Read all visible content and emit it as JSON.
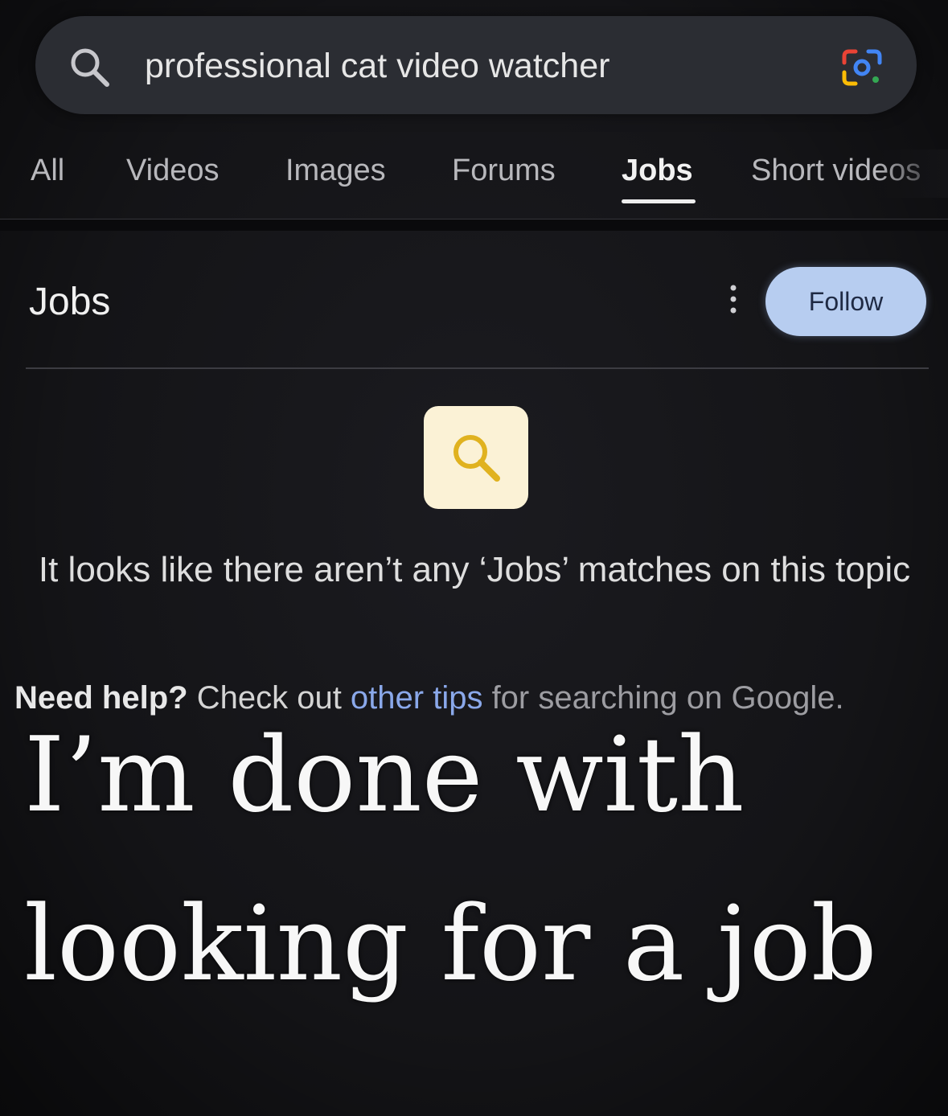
{
  "search": {
    "query": "professional cat video watcher",
    "icon": "search-icon",
    "lens_icon": "google-lens-icon"
  },
  "tabs": [
    {
      "label": "All",
      "active": false
    },
    {
      "label": "Videos",
      "active": false
    },
    {
      "label": "Images",
      "active": false
    },
    {
      "label": "Forums",
      "active": false
    },
    {
      "label": "Jobs",
      "active": true
    },
    {
      "label": "Short videos",
      "active": false
    }
  ],
  "section": {
    "title": "Jobs",
    "follow_label": "Follow",
    "more_icon": "more-vertical-icon"
  },
  "empty_state": {
    "icon": "search-icon",
    "message": "It looks like there aren’t any ‘Jobs’ matches on this topic",
    "help_bold": "Need help?",
    "help_prefix": " Check out ",
    "help_link": "other tips",
    "help_suffix": " for searching on Google."
  },
  "caption": {
    "line1": "I’m done with",
    "line2": "looking for a job"
  },
  "colors": {
    "background": "#141417",
    "search_bar": "#2b2d33",
    "follow_button": "#b7cdf0",
    "link": "#8aa8ea",
    "empty_icon_bg": "#fbf2d6",
    "empty_icon_fg": "#e0b21f"
  }
}
